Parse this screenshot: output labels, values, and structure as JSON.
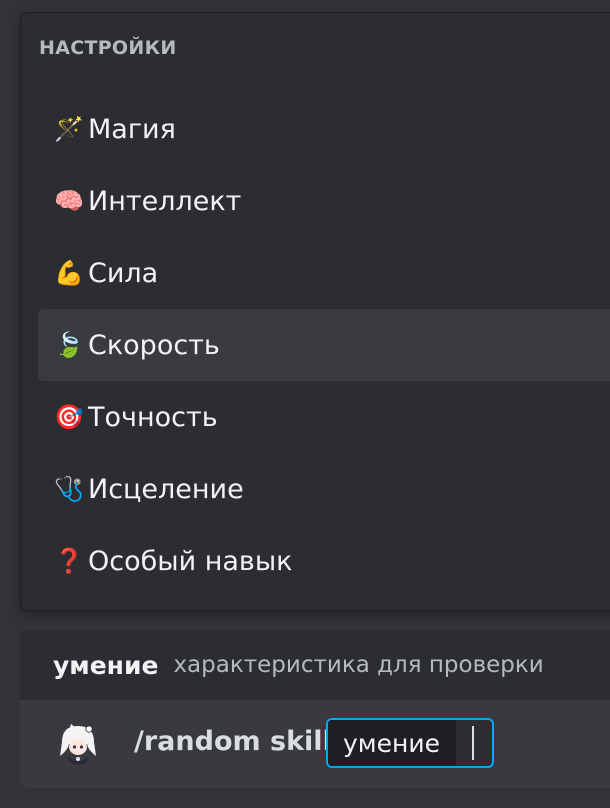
{
  "popup": {
    "header": "НАСТРОЙКИ",
    "options": [
      {
        "icon": "🪄",
        "icon_name": "magic-wand-icon",
        "label": "Магия",
        "active": false
      },
      {
        "icon": "🧠",
        "icon_name": "brain-icon",
        "label": "Интеллект",
        "active": false
      },
      {
        "icon": "💪",
        "icon_name": "flexed-biceps-icon",
        "label": "Сила",
        "active": false
      },
      {
        "icon": "🍃",
        "icon_name": "leaf-wind-icon",
        "label": "Скорость",
        "active": true
      },
      {
        "icon": "🎯",
        "icon_name": "target-icon",
        "label": "Точность",
        "active": false
      },
      {
        "icon": "🩺",
        "icon_name": "stethoscope-icon",
        "label": "Исцеление",
        "active": false
      },
      {
        "icon": "❓",
        "icon_name": "question-mark-icon",
        "label": "Особый навык",
        "active": false
      }
    ]
  },
  "param": {
    "name": "умение",
    "description": "характеристика для проверки"
  },
  "command": {
    "text": "/random skill",
    "option_name": "умение"
  },
  "colors": {
    "background": "#313338",
    "popup": "#2b2d31",
    "active_row": "#393b41",
    "command_row": "#383a40",
    "focus_border": "#00a8fc"
  }
}
